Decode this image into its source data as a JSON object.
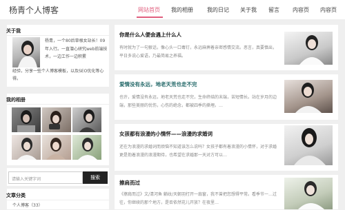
{
  "header": {
    "logo": "杨青个人博客",
    "nav": [
      {
        "label": "网站首页",
        "active": true
      },
      {
        "label": "我的相册",
        "active": false
      },
      {
        "label": "我的日记",
        "active": false
      },
      {
        "label": "关于我",
        "active": false
      },
      {
        "label": "留言",
        "active": false
      },
      {
        "label": "内容页",
        "active": false
      },
      {
        "label": "内容页",
        "active": false
      }
    ],
    "accent_color": "#e05d7d"
  },
  "sidebar": {
    "about": {
      "title": "关于我",
      "text_1": "杨青，一个80后草根女站长！09年入行。一直潜心研究web前端技术，一边工作一边积累",
      "text_2": "经验，分享一些个人博客模板，以及SEO优化等心得。"
    },
    "album": {
      "title": "我的相册"
    },
    "search": {
      "placeholder": "请输入关键字词",
      "button_label": "搜索"
    },
    "recommend": {
      "title": "文章分类",
      "first_item": "个人博客（33）"
    }
  },
  "articles": [
    {
      "title": "你是什么人便会遇上什么人",
      "title_style": "dark",
      "text": "有时就为了一句狠话，像心头一口毒钉，永远麻痹着亲密感情交流。恶言，真要慎出，平日多说心爱语，乃最简易之养福。",
      "image": "woman-by-window"
    },
    {
      "title": "爱情没有永远，地老天荒也走不完",
      "title_style": "teal",
      "text": "也许，爱情没有永远，地老天荒也走不完，生命终结的末端，苦短情长。站在岁月的边端，那些美丽的忧伤，心伤的绝念，都被四季的撕埋。…",
      "image": "woman-seated"
    },
    {
      "title": "女孩都有浪漫的小情怀——浪漫的求婚词",
      "title_style": "dark",
      "text": "还在为浪漫的求婚词而烦恼不知道该怎么说吗？女孩子都有着浪漫的小情怀，对于求婚更是抱着浪漫的浪漫期待，也希望在求婚那一天对方可以…",
      "image": "woman-long-hair"
    },
    {
      "title": "擦肩而过",
      "title_style": "dark",
      "text": "《擦肩而过》文/清河鱼 躺纹/天朝羽打开一扇窗，我不曾把您想得平常。看季节一…过往，你继续的那个地方，是否依然花儿开放？在夜里…",
      "image": "woman-field"
    }
  ]
}
